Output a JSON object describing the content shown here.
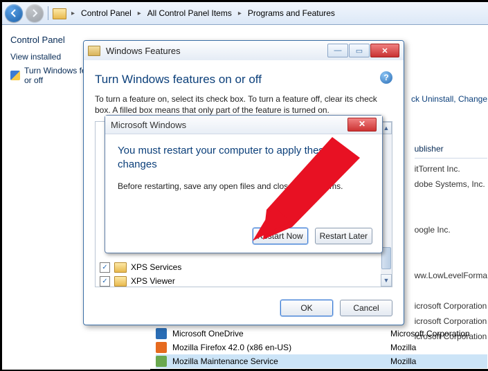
{
  "breadcrumb": {
    "items": [
      "Control Panel",
      "All Control Panel Items",
      "Programs and Features"
    ]
  },
  "sidebar": {
    "heading": "Control Panel",
    "links": {
      "view_installed": "View installed",
      "turn_features": "Turn Windows features on or off"
    }
  },
  "background_top_action": "ck Uninstall, Change",
  "background_table": {
    "header": "ublisher",
    "rows": [
      "itTorrent Inc.",
      "dobe Systems, Inc.",
      "",
      "",
      "oogle Inc.",
      "",
      "",
      "ww.LowLevelForma",
      "",
      "icrosoft Corporation",
      "icrosoft Corporation",
      "icrosoft Corporation"
    ]
  },
  "programs_list": [
    {
      "name": "Microsoft OneDrive",
      "publisher": "Microsoft Corporation",
      "icon": "#2a6db5"
    },
    {
      "name": "Mozilla Firefox 42.0 (x86 en-US)",
      "publisher": "Mozilla",
      "icon": "#e66a1f"
    },
    {
      "name": "Mozilla Maintenance Service",
      "publisher": "Mozilla",
      "icon": "#6aa84f"
    }
  ],
  "wf_dialog": {
    "title": "Windows Features",
    "heading": "Turn Windows features on or off",
    "description": "To turn a feature on, select its check box. To turn a feature off, clear its check box. A filled box means that only part of the feature is turned on.",
    "tree_items": [
      {
        "label": "XPS Services",
        "checked": true
      },
      {
        "label": "XPS Viewer",
        "checked": true
      }
    ],
    "ok": "OK",
    "cancel": "Cancel"
  },
  "ms_dialog": {
    "title": "Microsoft Windows",
    "heading": "You must restart your computer to apply these changes",
    "description": "Before restarting, save any open files and close all programs.",
    "restart_now": "Restart Now",
    "restart_later": "Restart Later"
  }
}
